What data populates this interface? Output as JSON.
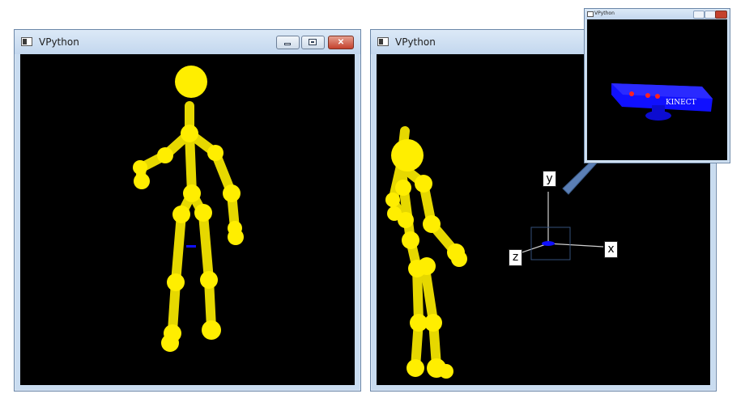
{
  "left_window": {
    "title": "VPython"
  },
  "right_window": {
    "title": "VPython"
  },
  "inset_window": {
    "title": "VPython",
    "sensor_label": "KINECT"
  },
  "axes": {
    "x": "x",
    "y": "y",
    "z": "z"
  },
  "colors": {
    "skeleton": "#ffee00",
    "background": "#000000",
    "sensor": "#1010ff",
    "arrow": "#5b7fb5",
    "title_bar": "#c9dcf0"
  },
  "icons": {
    "window_icon": "app-window-icon",
    "minimize": "minimize-icon",
    "maximize": "maximize-icon",
    "close": "close-icon"
  }
}
